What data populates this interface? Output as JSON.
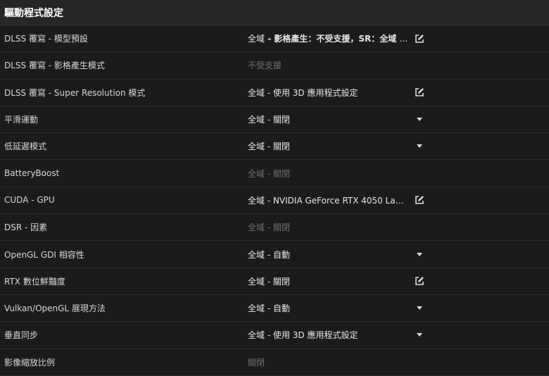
{
  "header": {
    "title": "驅動程式設定"
  },
  "rows": [
    {
      "label": "DLSS 覆寫 - 模型預設",
      "value_prefix": "全域",
      "value_rest": " - 影格產生：不受支援，SR：全域 - 預設...",
      "control": "edit-icon"
    },
    {
      "label": "DLSS 覆寫 - 影格產生模式",
      "value": "不受支援",
      "disabled": true,
      "control": null
    },
    {
      "label": "DLSS 覆寫 - Super Resolution 模式",
      "value": "全域 - 使用 3D 應用程式設定",
      "control": "edit-icon"
    },
    {
      "label": "平滑運動",
      "value": "全域 - 關閉",
      "control": "chevron-down-icon"
    },
    {
      "label": "低延遲模式",
      "value": "全域 - 關閉",
      "control": "chevron-down-icon"
    },
    {
      "label": "BatteryBoost",
      "value": "全域 - 關閉",
      "disabled": true,
      "control": null
    },
    {
      "label": "CUDA - GPU",
      "value": "全域 - NVIDIA GeForce RTX 4050 Laptop G...",
      "control": "edit-icon"
    },
    {
      "label": "DSR - 因素",
      "value": "全域 - 關閉",
      "disabled": true,
      "control": null
    },
    {
      "label": "OpenGL GDI 相容性",
      "value": "全域 - 自動",
      "control": "chevron-down-icon"
    },
    {
      "label": "RTX 數位鮮豔度",
      "value": "全域 - 關閉",
      "control": "edit-icon"
    },
    {
      "label": "Vulkan/OpenGL 展現方法",
      "value": "全域 - 自動",
      "control": "chevron-down-icon"
    },
    {
      "label": "垂直同步",
      "value": "全域 - 使用 3D 應用程式設定",
      "control": "chevron-down-icon"
    },
    {
      "label": "影像縮放比例",
      "value": "關閉",
      "disabled": true,
      "control": null
    }
  ]
}
